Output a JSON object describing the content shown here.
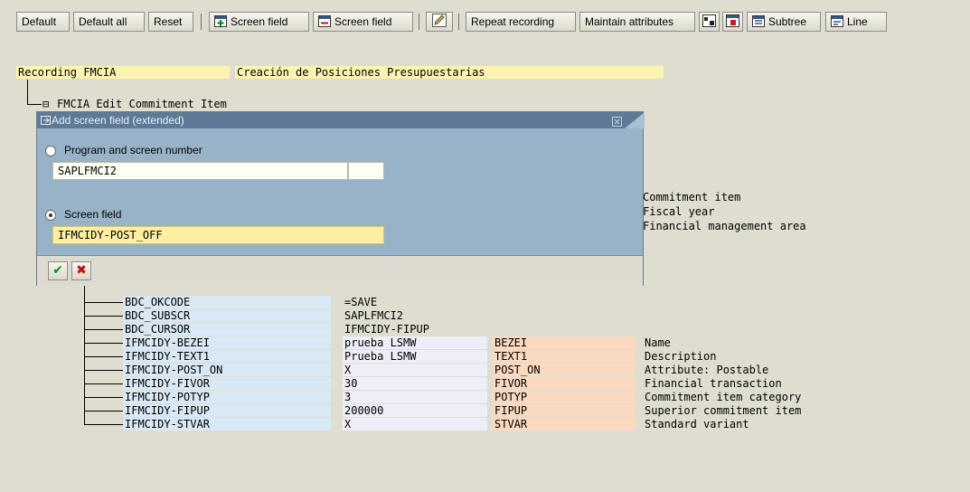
{
  "toolbar": {
    "default": "Default",
    "default_all": "Default all",
    "reset": "Reset",
    "screen_field_add": "Screen field",
    "screen_field_del": "Screen field",
    "repeat": "Repeat recording",
    "maintain": "Maintain attributes",
    "subtree": "Subtree",
    "line": "Line"
  },
  "recording": {
    "label": "Recording FMCIA",
    "description": "Creación de Posiciones Presupuestarias"
  },
  "screen_node": {
    "glyph": "⊟",
    "text": "FMCIA Edit Commitment Item"
  },
  "dialog": {
    "title": "Add screen field (extended)",
    "option1_label": "Program and screen number",
    "program_value": "SAPLFMCI2",
    "screen_number_value": "",
    "option2_label": "Screen field",
    "field_value": "IFMCIDY-POST_OFF"
  },
  "right_descriptions": [
    "Commitment item",
    "Fiscal year",
    "Financial management area"
  ],
  "rows": [
    {
      "field": "BDC_OKCODE",
      "value": "=SAVE",
      "name": "",
      "desc": ""
    },
    {
      "field": "BDC_SUBSCR",
      "value": "SAPLFMCI2",
      "name": "",
      "desc": ""
    },
    {
      "field": "BDC_CURSOR",
      "value": "IFMCIDY-FIPUP",
      "name": "",
      "desc": ""
    },
    {
      "field": "IFMCIDY-BEZEI",
      "value": "prueba LSMW",
      "name": "BEZEI",
      "desc": "Name"
    },
    {
      "field": "IFMCIDY-TEXT1",
      "value": "Prueba LSMW",
      "name": "TEXT1",
      "desc": "Description"
    },
    {
      "field": "IFMCIDY-POST_ON",
      "value": "X",
      "name": "POST_ON",
      "desc": "Attribute: Postable"
    },
    {
      "field": "IFMCIDY-FIVOR",
      "value": "30",
      "name": "FIVOR",
      "desc": "Financial transaction"
    },
    {
      "field": "IFMCIDY-POTYP",
      "value": "3",
      "name": "POTYP",
      "desc": "Commitment item category"
    },
    {
      "field": "IFMCIDY-FIPUP",
      "value": "200000",
      "name": "FIPUP",
      "desc": "Superior commitment item"
    },
    {
      "field": "IFMCIDY-STVAR",
      "value": "X",
      "name": "STVAR",
      "desc": "Standard variant"
    }
  ]
}
